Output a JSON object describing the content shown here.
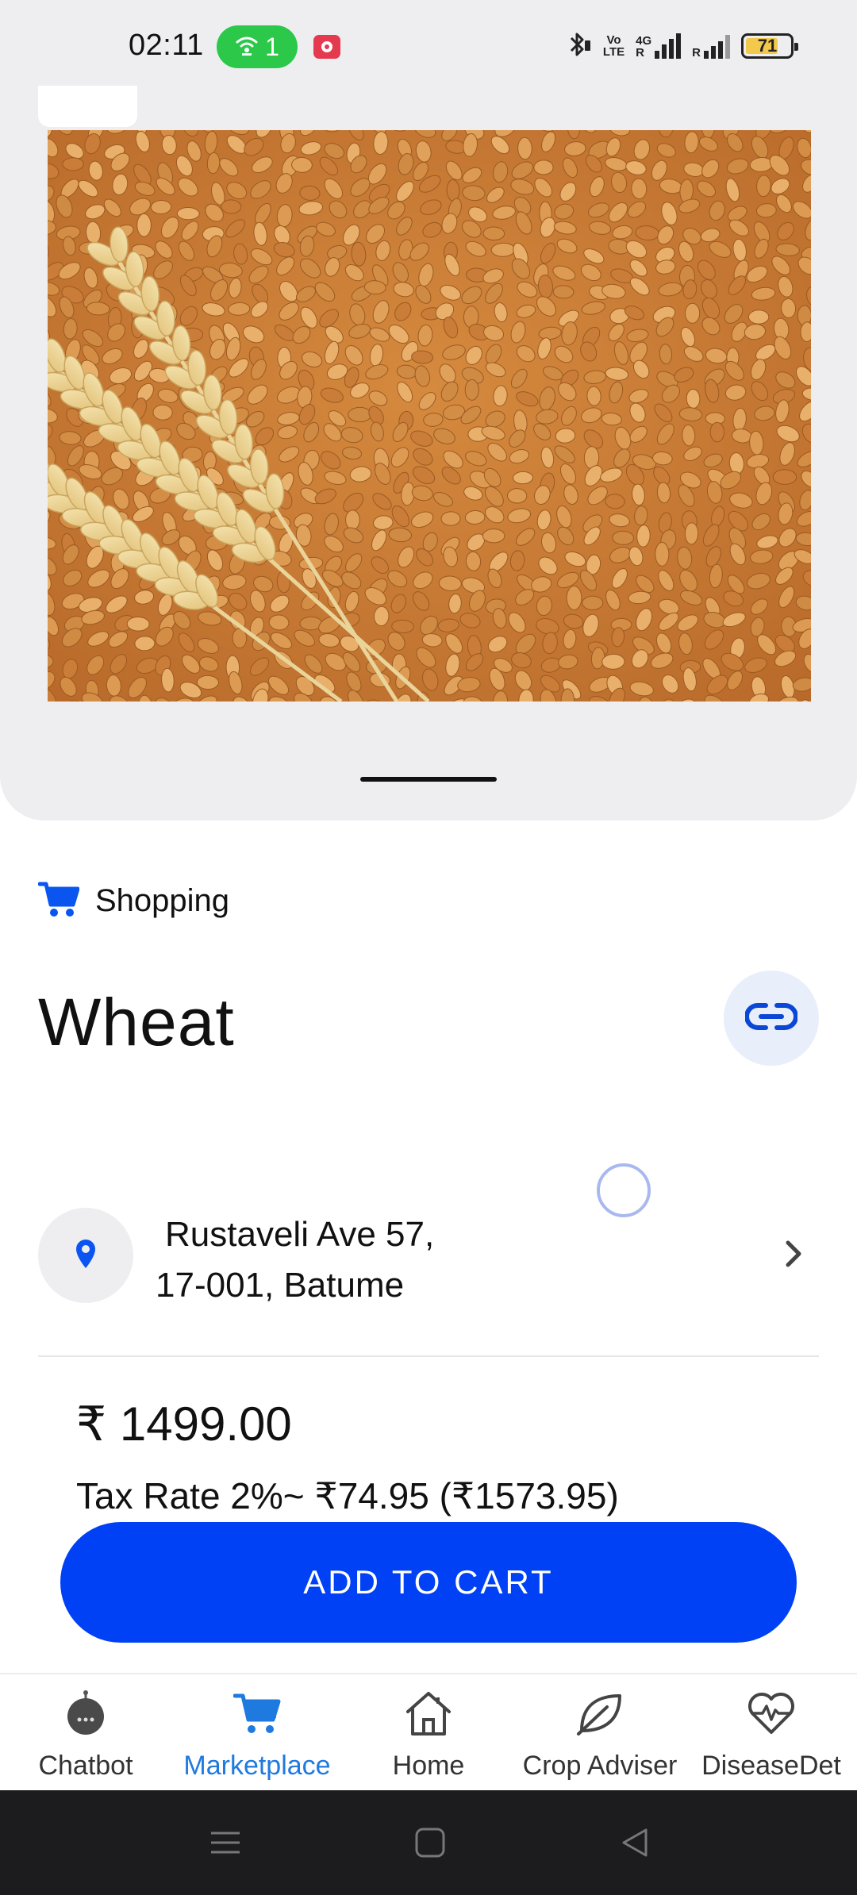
{
  "status_bar": {
    "time": "02:11",
    "hotspot_count": "1",
    "volte_label_top": "Vo",
    "volte_label_bottom": "LTE",
    "network_label": "4G",
    "roaming_label": "R",
    "battery_level": "71",
    "battery_fraction": 0.71
  },
  "product": {
    "category": "Shopping",
    "name": "Wheat",
    "image_alt": "wheat grains with wheat ears",
    "address_line1": "Rustaveli Ave 57,",
    "address_line2": "17-001, Batume",
    "price": "₹ 1499.00",
    "tax_text": "Tax Rate 2%~ ₹74.95 (₹1573.95)",
    "add_to_cart_label": "ADD TO CART"
  },
  "bottom_nav": {
    "items": [
      {
        "label": "Chatbot",
        "icon": "chatbot-icon",
        "active": false
      },
      {
        "label": "Marketplace",
        "icon": "cart-icon",
        "active": true
      },
      {
        "label": "Home",
        "icon": "home-icon",
        "active": false
      },
      {
        "label": "Crop Adviser",
        "icon": "leaf-icon",
        "active": false
      },
      {
        "label": "DiseaseDet",
        "icon": "heart-pulse-icon",
        "active": false
      }
    ]
  },
  "colors": {
    "accent": "#0041f5",
    "active_nav": "#1f7ae0",
    "sheet_bg": "#eeeef1",
    "hotspot": "#2bc84a"
  }
}
